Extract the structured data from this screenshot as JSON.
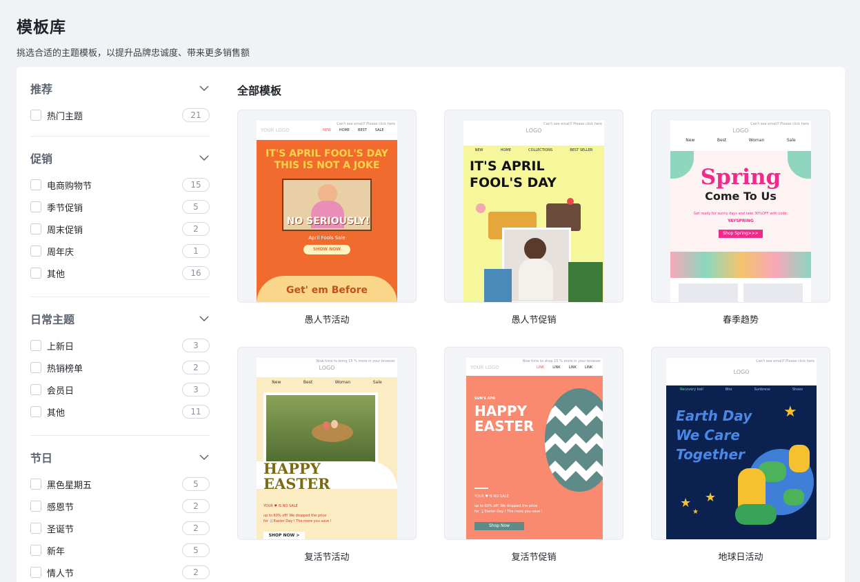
{
  "page": {
    "title": "模板库",
    "subtitle": "挑选合适的主题模板，以提升品牌忠诚度、带来更多销售额"
  },
  "sidebar": {
    "groups": [
      {
        "title": "推荐",
        "items": [
          {
            "label": "热门主题",
            "count": "21"
          }
        ]
      },
      {
        "title": "促销",
        "items": [
          {
            "label": "电商购物节",
            "count": "15"
          },
          {
            "label": "季节促销",
            "count": "5"
          },
          {
            "label": "周末促销",
            "count": "2"
          },
          {
            "label": "周年庆",
            "count": "1"
          },
          {
            "label": "其他",
            "count": "16"
          }
        ]
      },
      {
        "title": "日常主题",
        "items": [
          {
            "label": "上新日",
            "count": "3"
          },
          {
            "label": "热销榜单",
            "count": "2"
          },
          {
            "label": "会员日",
            "count": "3"
          },
          {
            "label": "其他",
            "count": "11"
          }
        ]
      },
      {
        "title": "节日",
        "items": [
          {
            "label": "黑色星期五",
            "count": "5"
          },
          {
            "label": "感恩节",
            "count": "2"
          },
          {
            "label": "圣诞节",
            "count": "2"
          },
          {
            "label": "新年",
            "count": "5"
          },
          {
            "label": "情人节",
            "count": "2"
          }
        ]
      }
    ]
  },
  "main": {
    "title": "全部模板",
    "templates": [
      {
        "name": "愚人节活动",
        "preview": {
          "note": "Can't see email? Please click here",
          "logo": "YOUR LOGO",
          "nav": [
            "NEW",
            "HOME",
            "BEST",
            "SALE"
          ],
          "headline1": "IT'S APRIL FOOL'S DAY",
          "headline2": "THIS IS NOT A JOKE",
          "banner": "NO SERIOUSLY!",
          "sub": "April Fools Sale",
          "cta": "SHOW NOW",
          "bottom": "Get' em Before"
        }
      },
      {
        "name": "愚人节促销",
        "preview": {
          "note": "Can't see email? Please click here",
          "logo": "LOGO",
          "nav": [
            "NEW",
            "HOME",
            "COLLECTIONS",
            "BEST SELLER"
          ],
          "headline1": "IT'S APRIL",
          "headline2": "FOOL'S DAY"
        }
      },
      {
        "name": "春季趋势",
        "preview": {
          "note": "Can't see email? Please click here",
          "logo": "LOGO",
          "nav": [
            "New",
            "Best",
            "Woman",
            "Sale"
          ],
          "headline1": "Spring",
          "headline2": "Come To Us",
          "sub": "Get ready for sunny days and take 30%OFF with code:",
          "code": "YAYSPRING",
          "cta": "Shop Spring>>>"
        }
      },
      {
        "name": "复活节活动",
        "preview": {
          "note": "Now time to bring 15 % more in your browser",
          "logo": "LOGO",
          "nav": [
            "New",
            "Best",
            "Woman",
            "Sale"
          ],
          "headline1": "HAPPY",
          "headline2": "EASTER",
          "sale": "YOUR ♥ IS NO SALE",
          "sub": "up to 60% off! We dropped the price",
          "sub2": "for 🐰Easter Day ! The more you save !",
          "cta": "SHOP NOW >"
        }
      },
      {
        "name": "复活节促销",
        "preview": {
          "note": "Now time to shop 15 % more in your browser",
          "logo": "YOUR LOGO",
          "nav": [
            "LINK",
            "LINK",
            "LINK",
            "LINK"
          ],
          "kicker": "SUN'S APR",
          "headline1": "HAPPY",
          "headline2": "EASTER",
          "sale": "YOUR ♥ IS NO SALE",
          "sub": "up to 60% off! We dropped the price",
          "sub2": "for 🐰Easter Day ! The more you save !",
          "cta": "Shop Now"
        }
      },
      {
        "name": "地球日活动",
        "preview": {
          "note": "Can't see email? Please click here",
          "logo": "LOGO",
          "nav": [
            "Recovery bell",
            "Bho",
            "Sunbrese",
            "Shoes"
          ],
          "headline1": "Earth Day",
          "headline2": "We Care",
          "headline3": "Together"
        }
      }
    ]
  },
  "colors": {
    "accent": "#ff6a2b",
    "brand": "#1f2329",
    "border": "#e6e8ee"
  }
}
